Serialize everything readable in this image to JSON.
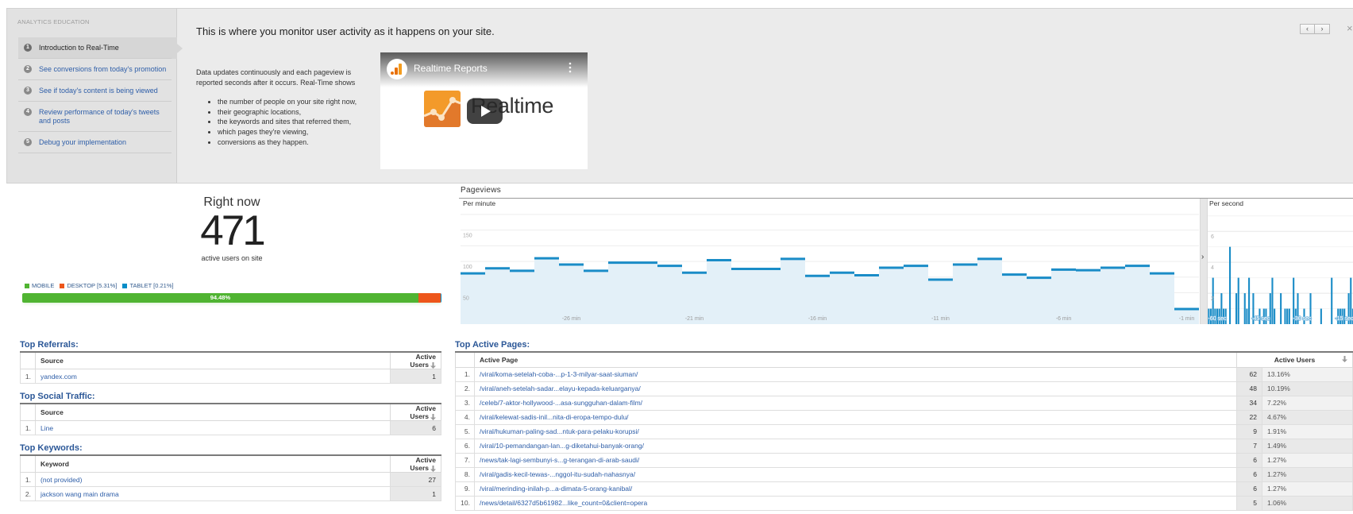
{
  "education": {
    "heading": "ANALYTICS EDUCATION",
    "steps": [
      {
        "num": "1",
        "label": "Introduction to Real-Time",
        "active": true
      },
      {
        "num": "2",
        "label": "See conversions from today's promotion",
        "active": false
      },
      {
        "num": "3",
        "label": "See if today's content is being viewed",
        "active": false
      },
      {
        "num": "4",
        "label": "Review performance of today's tweets and posts",
        "active": false
      },
      {
        "num": "5",
        "label": "Debug your implementation",
        "active": false
      }
    ],
    "title": "This is where you monitor user activity as it happens on your site.",
    "intro": "Data updates continuously and each pageview is reported seconds after it occurs. Real-Time shows",
    "bullets": [
      "the number of people on your site right now,",
      "their geographic locations,",
      "the keywords and sites that referred them,",
      "which pages they're viewing,",
      "conversions as they happen."
    ],
    "video": {
      "title": "Realtime Reports",
      "logo_text": "Realtime",
      "menu": "⋮",
      "brand_orange": "#f08a24"
    },
    "nav": {
      "prev": "‹",
      "next": "›",
      "close": "×"
    }
  },
  "right_now": {
    "title": "Right now",
    "count": "471",
    "subtitle": "active users on site",
    "devices": [
      {
        "label": "MOBILE",
        "percent": 94.48,
        "color": "#50b432",
        "bar_label": "94.48%"
      },
      {
        "label": "DESKTOP [5.31%]",
        "percent": 5.31,
        "color": "#ed561b",
        "bar_label": ""
      },
      {
        "label": "TABLET [0.21%]",
        "percent": 0.21,
        "color": "#058dc7",
        "bar_label": ""
      }
    ]
  },
  "pageviews": {
    "title": "Pageviews",
    "per_minute_label": "Per minute",
    "per_second_label": "Per second",
    "expand": "›",
    "series_color": "#1a8cc7",
    "fill_color": "#e3f0f8"
  },
  "chart_data": [
    {
      "type": "area",
      "step": true,
      "title": "Per minute",
      "values": [
        81,
        89,
        85,
        105,
        95,
        85,
        98,
        98,
        93,
        82,
        102,
        88,
        88,
        104,
        77,
        82,
        78,
        90,
        93,
        71,
        95,
        104,
        79,
        74,
        87,
        86,
        90,
        93,
        81,
        24
      ],
      "x_ticks": [
        {
          "index": 4,
          "label": "-26 min"
        },
        {
          "index": 9,
          "label": "-21 min"
        },
        {
          "index": 14,
          "label": "-16 min"
        },
        {
          "index": 19,
          "label": "-11 min"
        },
        {
          "index": 24,
          "label": "-6 min"
        },
        {
          "index": 29,
          "label": "-1 min"
        }
      ],
      "y_ticks": [
        50,
        100,
        150
      ],
      "ylim": [
        0,
        185
      ],
      "grid": true
    },
    {
      "type": "bar",
      "title": "Per second",
      "values": [
        1,
        1,
        3,
        1,
        1,
        1,
        2,
        1,
        1,
        0,
        5,
        0,
        0,
        2,
        3,
        0,
        0,
        2,
        1,
        3,
        0,
        2,
        0,
        0,
        1,
        0,
        1,
        1,
        0,
        2,
        3,
        1,
        0,
        0,
        2,
        0,
        1,
        1,
        1,
        0,
        3,
        1,
        2,
        0,
        0,
        1,
        0,
        0,
        2,
        0,
        0,
        0,
        0,
        1,
        0,
        0,
        0,
        0,
        3,
        0,
        0,
        1,
        1,
        1,
        1,
        0,
        2,
        3,
        1
      ],
      "x_ticks": [
        {
          "at": 4.5,
          "label": "-60 sec"
        },
        {
          "at": 25,
          "label": "-45 sec"
        },
        {
          "at": 44.6,
          "label": "-30 sec"
        },
        {
          "at": 64.4,
          "label": "-15 sec"
        }
      ],
      "y_ticks": [
        2,
        4,
        6
      ],
      "ylim": [
        0,
        7.5
      ],
      "grid": true
    }
  ],
  "tables": {
    "referrals": {
      "title": "Top Referrals:",
      "col_label": "Source",
      "value_label": "Active Users",
      "rows": [
        {
          "rank": "1.",
          "name": "yandex.com",
          "value": "1"
        }
      ]
    },
    "social": {
      "title": "Top Social Traffic:",
      "col_label": "Source",
      "value_label": "Active Users",
      "rows": [
        {
          "rank": "1.",
          "name": "Line",
          "value": "6"
        }
      ]
    },
    "keywords": {
      "title": "Top Keywords:",
      "col_label": "Keyword",
      "value_label": "Active Users",
      "rows": [
        {
          "rank": "1.",
          "name": "(not provided)",
          "value": "27"
        },
        {
          "rank": "2.",
          "name": "jackson wang main drama",
          "value": "1"
        }
      ]
    },
    "pages": {
      "title": "Top Active Pages:",
      "col_label": "Active Page",
      "value_label": "Active Users",
      "rows": [
        {
          "rank": "1.",
          "name": "/viral/koma-setelah-coba-...p-1-3-milyar-saat-siuman/",
          "value": "62",
          "pct": "13.16%"
        },
        {
          "rank": "2.",
          "name": "/viral/aneh-setelah-sadar...elayu-kepada-keluarganya/",
          "value": "48",
          "pct": "10.19%"
        },
        {
          "rank": "3.",
          "name": "/celeb/7-aktor-hollywood-...asa-sungguhan-dalam-film/",
          "value": "34",
          "pct": "7.22%"
        },
        {
          "rank": "4.",
          "name": "/viral/kelewat-sadis-inil...nita-di-eropa-tempo-dulu/",
          "value": "22",
          "pct": "4.67%"
        },
        {
          "rank": "5.",
          "name": "/viral/hukuman-paling-sad...ntuk-para-pelaku-korupsi/",
          "value": "9",
          "pct": "1.91%"
        },
        {
          "rank": "6.",
          "name": "/viral/10-pemandangan-lan...g-diketahui-banyak-orang/",
          "value": "7",
          "pct": "1.49%"
        },
        {
          "rank": "7.",
          "name": "/news/tak-lagi-sembunyi-s...g-terangan-di-arab-saudi/",
          "value": "6",
          "pct": "1.27%"
        },
        {
          "rank": "8.",
          "name": "/viral/gadis-kecil-tewas-...nggol-itu-sudah-nahasnya/",
          "value": "6",
          "pct": "1.27%"
        },
        {
          "rank": "9.",
          "name": "/viral/merinding-inilah-p...a-dimata-5-orang-kanibal/",
          "value": "6",
          "pct": "1.27%"
        },
        {
          "rank": "10.",
          "name": "/news/detail/6327d5b61982...like_count=0&client=opera",
          "value": "5",
          "pct": "1.06%"
        }
      ]
    }
  }
}
